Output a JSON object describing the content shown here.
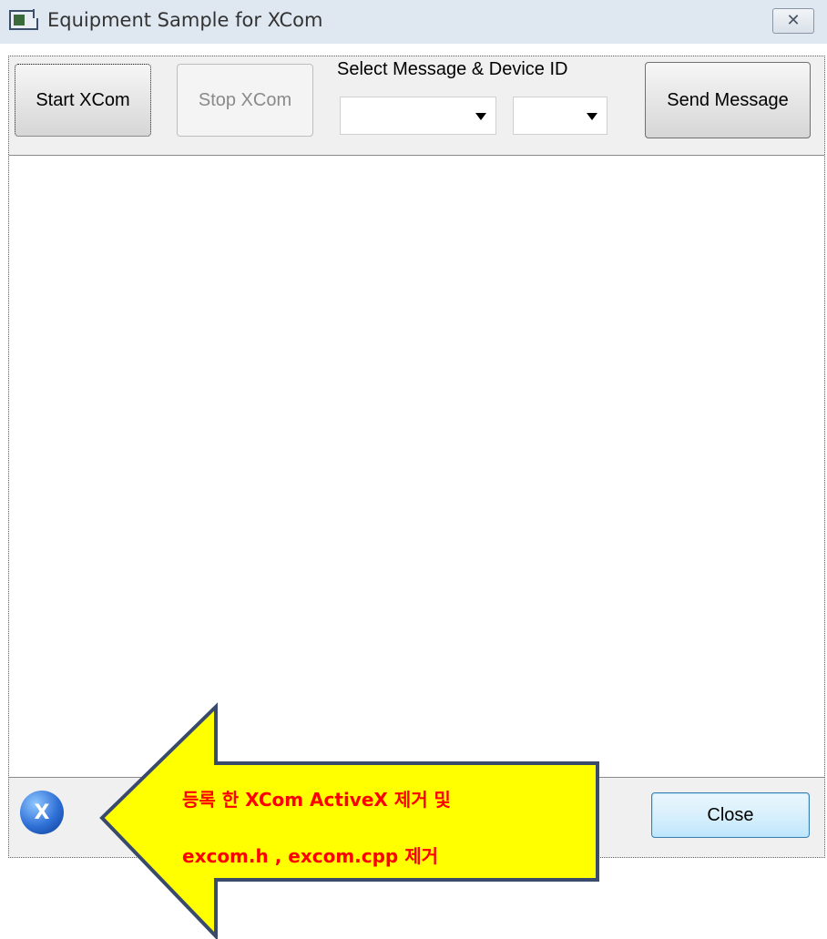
{
  "window": {
    "title": "Equipment Sample for XCom",
    "close_glyph": "✕"
  },
  "toolbar": {
    "start_label": "Start XCom",
    "stop_label": "Stop XCom",
    "select_label": "Select Message & Device ID",
    "message_value": "",
    "device_value": "",
    "send_label": "Send Message"
  },
  "footer": {
    "close_label": "Close",
    "logo_text": "X"
  },
  "callout": {
    "line1": "등록 한 XCom ActiveX 제거 및",
    "line2": "excom.h , excom.cpp 제거",
    "fill_color": "#ffff00",
    "stroke_color": "#3a4a6a",
    "text_color": "#ff0000"
  }
}
